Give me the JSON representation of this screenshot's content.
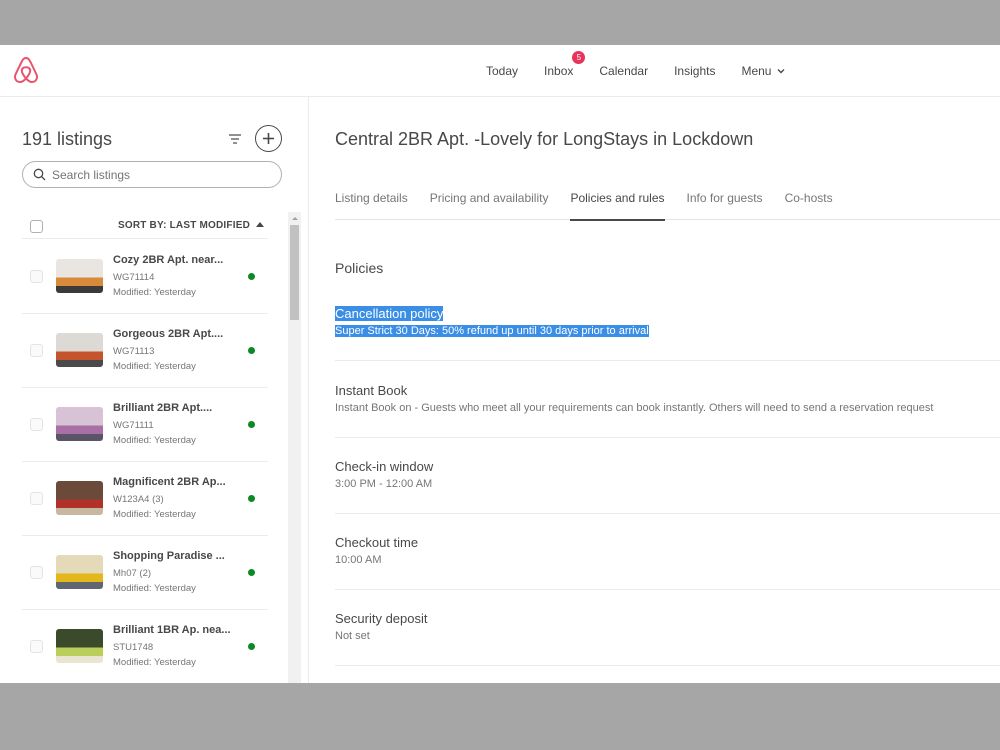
{
  "header": {
    "logo": "airbnb-logo",
    "nav": [
      {
        "label": "Today"
      },
      {
        "label": "Inbox",
        "badge": "5"
      },
      {
        "label": "Calendar"
      },
      {
        "label": "Insights"
      },
      {
        "label": "Menu"
      }
    ]
  },
  "sidebar": {
    "count_label": "191 listings",
    "search_placeholder": "Search listings",
    "sort_label": "SORT BY: LAST MODIFIED",
    "items": [
      {
        "title": "Cozy 2BR Apt. near...",
        "code": "WG71114",
        "modified": "Modified: Yesterday",
        "status": "active",
        "thumb_colors": [
          "#e9e6e1",
          "#d8893a",
          "#3a3a3a"
        ]
      },
      {
        "title": "Gorgeous 2BR Apt....",
        "code": "WG71113",
        "modified": "Modified: Yesterday",
        "status": "active",
        "thumb_colors": [
          "#dddad6",
          "#c4542e",
          "#4a4a4a"
        ]
      },
      {
        "title": "Brilliant 2BR Apt....",
        "code": "WG71111",
        "modified": "Modified: Yesterday",
        "status": "active",
        "thumb_colors": [
          "#d8c3d6",
          "#a870a6",
          "#595466"
        ]
      },
      {
        "title": "Magnificent 2BR Ap...",
        "code": "W123A4 (3)",
        "modified": "Modified: Yesterday",
        "status": "active",
        "thumb_colors": [
          "#6b4a3a",
          "#b0322a",
          "#c9b8a0"
        ]
      },
      {
        "title": "Shopping Paradise ...",
        "code": "Mh07 (2)",
        "modified": "Modified: Yesterday",
        "status": "active",
        "thumb_colors": [
          "#e4d9b8",
          "#e2b81c",
          "#5f6670"
        ]
      },
      {
        "title": "Brilliant 1BR Ap. nea...",
        "code": "STU1748",
        "modified": "Modified: Yesterday",
        "status": "active",
        "thumb_colors": [
          "#3c4a2c",
          "#b9cf5a",
          "#e8e6d0"
        ]
      }
    ]
  },
  "main": {
    "title": "Central 2BR Apt. -Lovely for LongStays in Lockdown",
    "tabs": [
      {
        "label": "Listing details"
      },
      {
        "label": "Pricing and availability"
      },
      {
        "label": "Policies and rules",
        "active": true
      },
      {
        "label": "Info for guests"
      },
      {
        "label": "Co-hosts"
      }
    ],
    "section_title": "Policies",
    "policies": [
      {
        "label": "Cancellation policy",
        "value": "Super Strict 30 Days: 50% refund up until 30 days prior to arrival",
        "selected": true
      },
      {
        "label": "Instant Book",
        "value": "Instant Book on - Guests who meet all your requirements can book instantly. Others will need to send a reservation request"
      },
      {
        "label": "Check-in window",
        "value": "3:00 PM - 12:00 AM"
      },
      {
        "label": "Checkout time",
        "value": "10:00 AM"
      },
      {
        "label": "Security deposit",
        "value": "Not set"
      }
    ]
  },
  "colors": {
    "brand": "#ff5a5f",
    "badge": "#e8345a",
    "status_active": "#0a8a24",
    "selection": "#3a8ee6"
  }
}
